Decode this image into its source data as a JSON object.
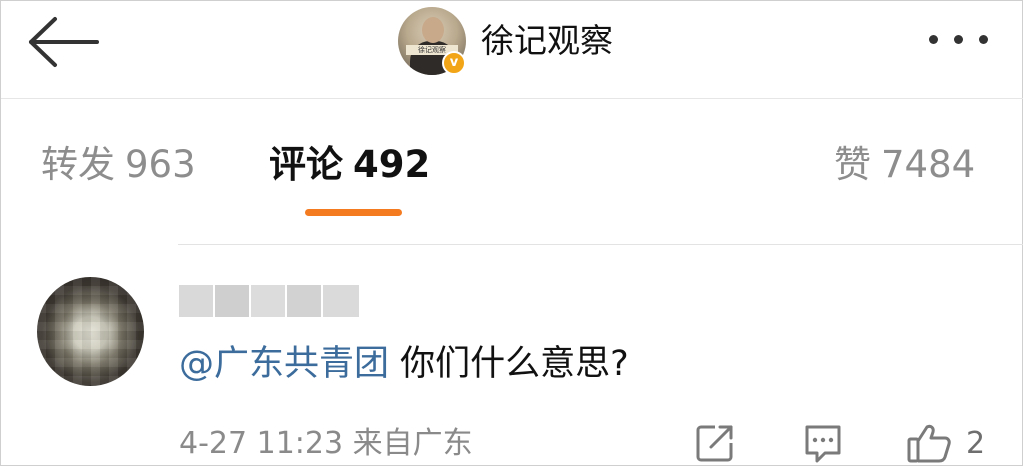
{
  "header": {
    "account_name": "徐记观察",
    "avatar_plate": "徐记观察",
    "verified_mark": "v"
  },
  "tabs": [
    {
      "label": "转发",
      "count": "963"
    },
    {
      "label": "评论",
      "count": "492"
    },
    {
      "label": "赞",
      "count": "7484"
    }
  ],
  "active_tab": "评论",
  "comment": {
    "mention": "@广东共青团",
    "text": "你们什么意思?",
    "time": "4-27 11:23",
    "source": "来自广东",
    "like_count": "2"
  },
  "icons": {
    "back": "back-arrow-icon",
    "more": "more-dots-icon",
    "share": "share-icon",
    "reply": "comment-icon",
    "like": "thumbs-up-icon"
  },
  "colors": {
    "accent": "#f47b20",
    "link": "#3c6c9c",
    "verified": "#f2a516"
  }
}
